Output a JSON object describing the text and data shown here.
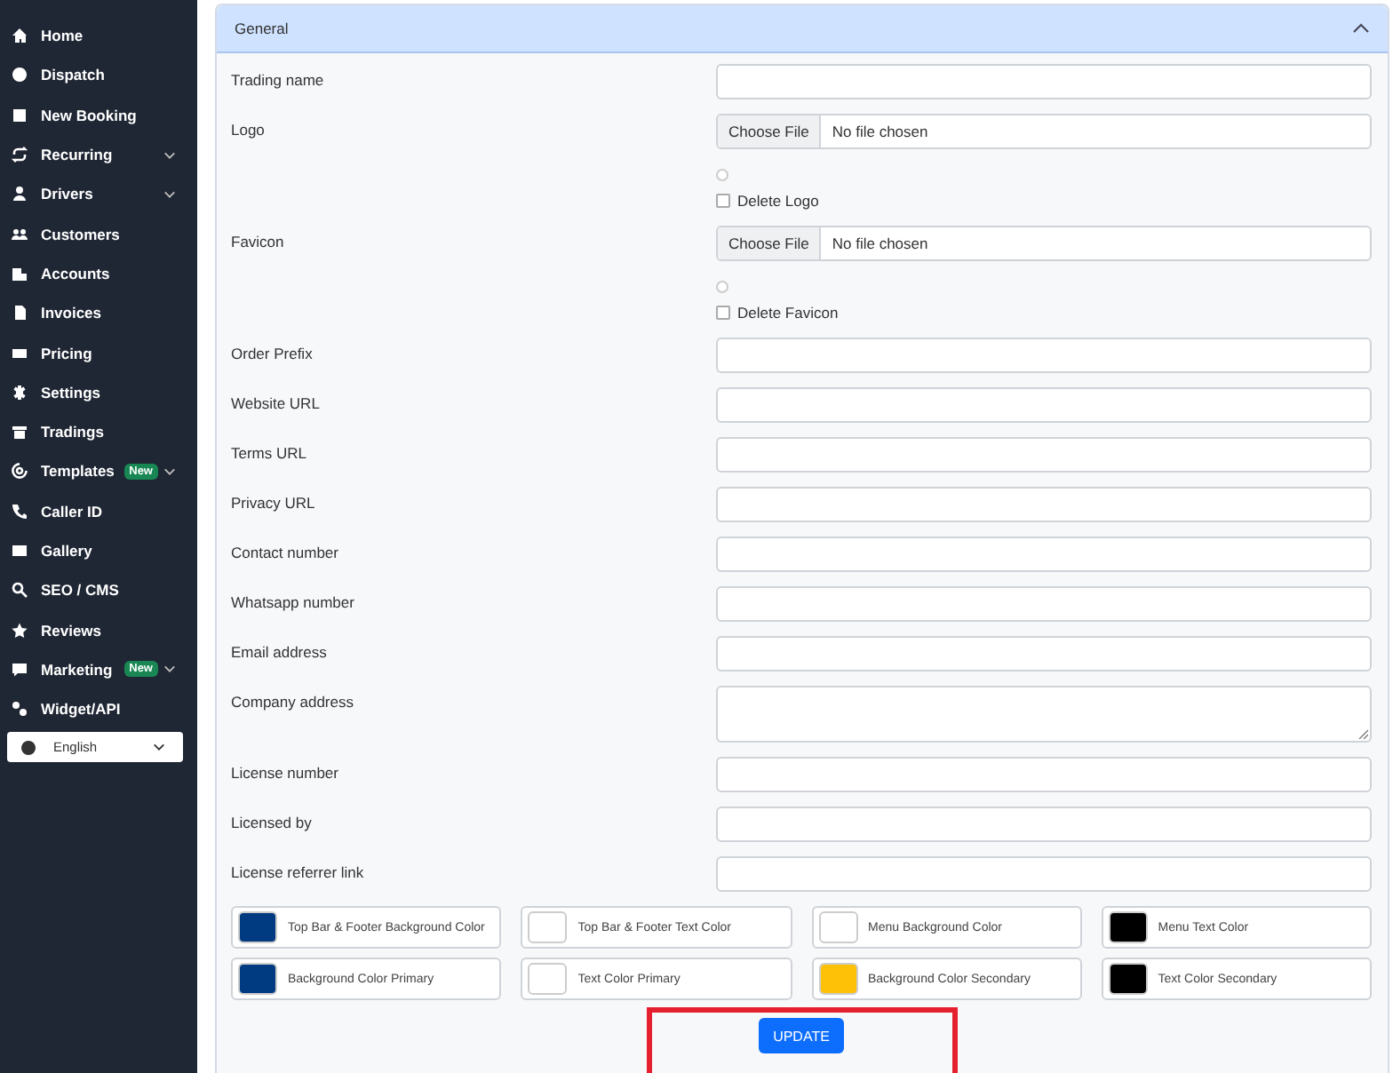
{
  "sidebar": {
    "items": [
      {
        "label": "Home",
        "expandable": false
      },
      {
        "label": "Dispatch",
        "expandable": false
      },
      {
        "label": "New Booking",
        "expandable": false
      },
      {
        "label": "Recurring",
        "expandable": true
      },
      {
        "label": "Drivers",
        "expandable": true
      },
      {
        "label": "Customers",
        "expandable": false
      },
      {
        "label": "Accounts",
        "expandable": false
      },
      {
        "label": "Invoices",
        "expandable": false
      },
      {
        "label": "Pricing",
        "expandable": false
      },
      {
        "label": "Settings",
        "expandable": false
      },
      {
        "label": "Tradings",
        "expandable": false
      },
      {
        "label": "Templates",
        "badge": "New",
        "expandable": true
      },
      {
        "label": "Caller ID",
        "expandable": false
      },
      {
        "label": "Gallery",
        "expandable": false
      },
      {
        "label": "SEO / CMS",
        "expandable": false
      },
      {
        "label": "Reviews",
        "expandable": false
      },
      {
        "label": "Marketing",
        "badge": "New",
        "expandable": true
      },
      {
        "label": "Widget/API",
        "expandable": false
      }
    ],
    "language": "English"
  },
  "section": {
    "title": "General",
    "expanded": true
  },
  "fields": [
    {
      "kind": "text",
      "label": "Trading name"
    },
    {
      "kind": "file",
      "label": "Logo",
      "button": "Choose File",
      "status": "No file chosen",
      "radio_selected": false,
      "delete_label": "Delete Logo",
      "delete_checked": false
    },
    {
      "kind": "file",
      "label": "Favicon",
      "button": "Choose File",
      "status": "No file chosen",
      "radio_selected": false,
      "delete_label": "Delete Favicon",
      "delete_checked": false
    },
    {
      "kind": "text",
      "label": "Order Prefix"
    },
    {
      "kind": "text",
      "label": "Website URL"
    },
    {
      "kind": "text",
      "label": "Terms URL"
    },
    {
      "kind": "text",
      "label": "Privacy URL"
    },
    {
      "kind": "text",
      "label": "Contact number"
    },
    {
      "kind": "text",
      "label": "Whatsapp number"
    },
    {
      "kind": "text",
      "label": "Email address"
    },
    {
      "kind": "textarea",
      "label": "Company address"
    },
    {
      "kind": "text",
      "label": "License number"
    },
    {
      "kind": "text",
      "label": "Licensed by"
    },
    {
      "kind": "text",
      "label": "License referrer link"
    }
  ],
  "colors": [
    {
      "label": "Top Bar & Footer Background Color",
      "color": "#003a80"
    },
    {
      "label": "Top Bar & Footer Text Color",
      "color": "#ffffff"
    },
    {
      "label": "Menu Background Color",
      "color": "#ffffff"
    },
    {
      "label": "Menu Text Color",
      "color": "#000000"
    },
    {
      "label": "Background Color Primary",
      "color": "#003a80"
    },
    {
      "label": "Text Color Primary",
      "color": "#ffffff"
    },
    {
      "label": "Background Color Secondary",
      "color": "#ffc107"
    },
    {
      "label": "Text Color Secondary",
      "color": "#000000"
    }
  ],
  "update_button": {
    "label": "UPDATE",
    "highlighted": true
  }
}
